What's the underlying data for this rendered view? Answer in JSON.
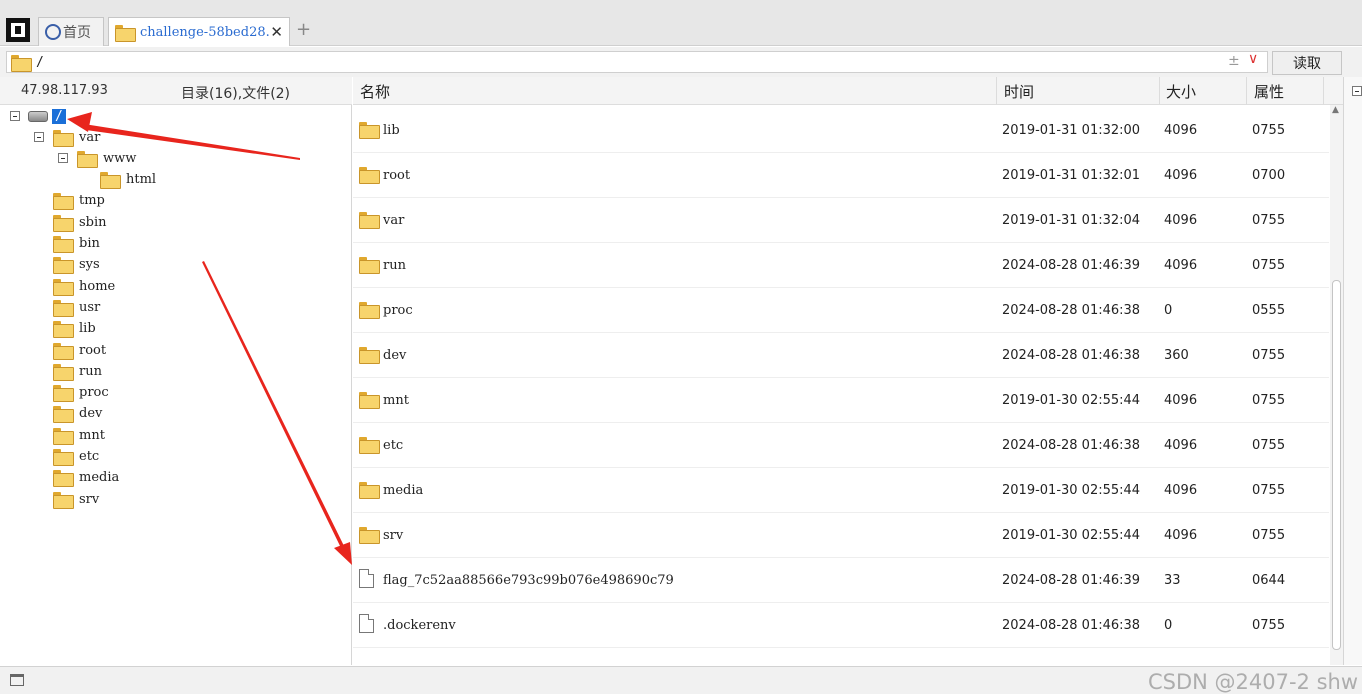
{
  "tabs": {
    "home_label": "首页",
    "active_label": "challenge-58bed28.",
    "close_glyph": "✕",
    "add_glyph": "+"
  },
  "address": {
    "path": "/",
    "sort_glyph": "±",
    "dropdown_glyph": "∨",
    "read_label": "读取"
  },
  "tree": {
    "host": "47.98.117.93",
    "summary": "目录(16),文件(2)",
    "root_label": "/",
    "nodes": [
      {
        "label": "var",
        "depth": 1,
        "expanded": true
      },
      {
        "label": "www",
        "depth": 2,
        "expanded": true
      },
      {
        "label": "html",
        "depth": 3
      },
      {
        "label": "tmp",
        "depth": 1
      },
      {
        "label": "sbin",
        "depth": 1
      },
      {
        "label": "bin",
        "depth": 1
      },
      {
        "label": "sys",
        "depth": 1
      },
      {
        "label": "home",
        "depth": 1
      },
      {
        "label": "usr",
        "depth": 1
      },
      {
        "label": "lib",
        "depth": 1
      },
      {
        "label": "root",
        "depth": 1
      },
      {
        "label": "run",
        "depth": 1
      },
      {
        "label": "proc",
        "depth": 1
      },
      {
        "label": "dev",
        "depth": 1
      },
      {
        "label": "mnt",
        "depth": 1
      },
      {
        "label": "etc",
        "depth": 1
      },
      {
        "label": "media",
        "depth": 1
      },
      {
        "label": "srv",
        "depth": 1
      }
    ]
  },
  "list": {
    "columns": {
      "name": "名称",
      "time": "时间",
      "size": "大小",
      "perm": "属性"
    },
    "rows": [
      {
        "type": "folder",
        "name": "lib",
        "time": "2019-01-31 01:32:00",
        "size": "4096",
        "perm": "0755"
      },
      {
        "type": "folder",
        "name": "root",
        "time": "2019-01-31 01:32:01",
        "size": "4096",
        "perm": "0700"
      },
      {
        "type": "folder",
        "name": "var",
        "time": "2019-01-31 01:32:04",
        "size": "4096",
        "perm": "0755"
      },
      {
        "type": "folder",
        "name": "run",
        "time": "2024-08-28 01:46:39",
        "size": "4096",
        "perm": "0755"
      },
      {
        "type": "folder",
        "name": "proc",
        "time": "2024-08-28 01:46:38",
        "size": "0",
        "perm": "0555"
      },
      {
        "type": "folder",
        "name": "dev",
        "time": "2024-08-28 01:46:38",
        "size": "360",
        "perm": "0755"
      },
      {
        "type": "folder",
        "name": "mnt",
        "time": "2019-01-30 02:55:44",
        "size": "4096",
        "perm": "0755"
      },
      {
        "type": "folder",
        "name": "etc",
        "time": "2024-08-28 01:46:38",
        "size": "4096",
        "perm": "0755"
      },
      {
        "type": "folder",
        "name": "media",
        "time": "2019-01-30 02:55:44",
        "size": "4096",
        "perm": "0755"
      },
      {
        "type": "folder",
        "name": "srv",
        "time": "2019-01-30 02:55:44",
        "size": "4096",
        "perm": "0755"
      },
      {
        "type": "file",
        "name": "flag_7c52aa88566e793c99b076e498690c79",
        "time": "2024-08-28 01:46:39",
        "size": "33",
        "perm": "0644"
      },
      {
        "type": "file",
        "name": ".dockerenv",
        "time": "2024-08-28 01:46:38",
        "size": "0",
        "perm": "0755"
      }
    ]
  },
  "watermark": "CSDN @2407-2 shw",
  "colors": {
    "arrow": "#e8251d",
    "selection": "#1a6fd8",
    "folder": "#f7d46c"
  }
}
